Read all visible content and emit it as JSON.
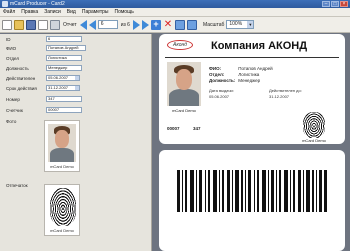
{
  "window": {
    "title": "mCard Producer - Card2"
  },
  "menu": [
    "Файл",
    "Правка",
    "Записи",
    "Вид",
    "Параметры",
    "Помощь"
  ],
  "toolbar": {
    "report_label": "Отчет",
    "record_value": "6",
    "record_total": "из 6",
    "scale_label": "Масштаб",
    "scale_value": "100%"
  },
  "fields": {
    "id": {
      "label": "ID",
      "value": "6"
    },
    "fio": {
      "label": "ФИО",
      "value": "Потапов Андрей"
    },
    "department": {
      "label": "Отдел",
      "value": "Логистика"
    },
    "position": {
      "label": "Должность",
      "value": "Менеджер"
    },
    "valid_from": {
      "label": "Действителен",
      "value": "05.06.2007"
    },
    "valid_to": {
      "label": "Срок действия",
      "value": "31.12.2007"
    },
    "number": {
      "label": "Номер",
      "value": "347"
    },
    "counter": {
      "label": "Счетчик",
      "value": "00007"
    },
    "photo_label": "Фото",
    "fingerprint_label": "Отпечаток"
  },
  "captions": {
    "photo": "mCard Demo",
    "fingerprint": "mCard Demo"
  },
  "card": {
    "logo": "Аконд",
    "company": "Компания АКОНД",
    "fio_label": "ФИО:",
    "fio_value": "Потапов Андрей",
    "dept_label": "Отдел:",
    "dept_value": "Логистика",
    "pos_label": "Должность:",
    "pos_value": "Менеджер",
    "issued_label": "Дата выдачи:",
    "issued_value": "05.06.2007",
    "valid_label": "Действителен до:",
    "valid_value": "31.12.2007",
    "photo_caption": "mCard Demo",
    "counter": "00007",
    "number": "347",
    "finger_caption": "mCard Demo"
  },
  "colors": {
    "title_bar": "#2e5a9e",
    "canvas": "#6e7480",
    "panel": "#e6e4dd",
    "logo_accent": "#cc3333"
  }
}
